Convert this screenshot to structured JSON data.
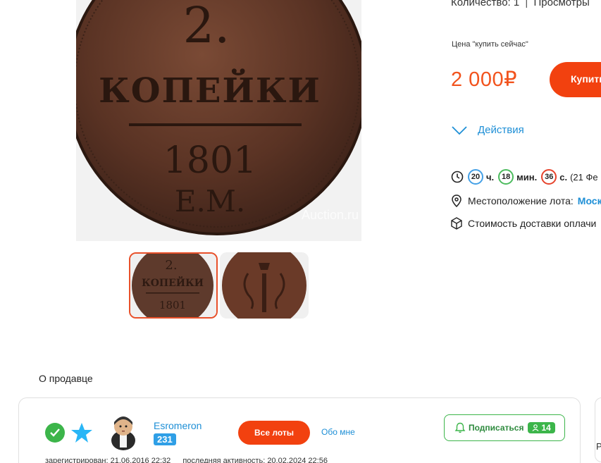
{
  "header": {
    "quantity_text": "Количество: 1",
    "views_text": "Просмотры"
  },
  "gallery": {
    "main_image": "coin-2-kopeks-1801-reverse",
    "coin_denomination": "2.",
    "coin_word": "КОПЕЙКИ",
    "coin_year": "1801",
    "coin_mint": "Е.М.",
    "watermark": "Auction.ru",
    "thumbnails": [
      {
        "image": "coin-reverse-thumb",
        "label_denomination": "2.",
        "label_word": "КОПЕЙКИ",
        "label_year": "1801",
        "selected": true
      },
      {
        "image": "coin-obverse-monogram-thumb",
        "selected": false
      }
    ]
  },
  "purchase": {
    "price_caption": "Цена \"купить сейчас\"",
    "price": "2 000₽",
    "buy_button": "Купить",
    "actions_label": "Действия"
  },
  "timer": {
    "hours": "20",
    "hours_unit": "ч.",
    "minutes": "18",
    "minutes_unit": "мин.",
    "seconds": "36",
    "seconds_unit": "с.",
    "end_date": "(21 Фе"
  },
  "lot_info": {
    "location_label": "Местоположение лота:",
    "location_value": "Моск",
    "delivery_text": "Стоимость доставки оплачи"
  },
  "seller": {
    "heading": "О продавце",
    "name": "Esromeron",
    "rating": "231",
    "all_lots_button": "Все лоты",
    "about_link": "Обо мне",
    "subscribe_label": "Подписаться",
    "subscribers_count": "14",
    "registered_text": "зарегистрирован: 21.06.2016 22:32",
    "last_active_text": "последняя активность: 20.02.2024 22:56",
    "side_card_letter": "Р"
  },
  "colors": {
    "accent_orange": "#f2410f",
    "price_orange": "#f2531d",
    "link_blue": "#1e8fd6",
    "success_green": "#3cb54a"
  }
}
